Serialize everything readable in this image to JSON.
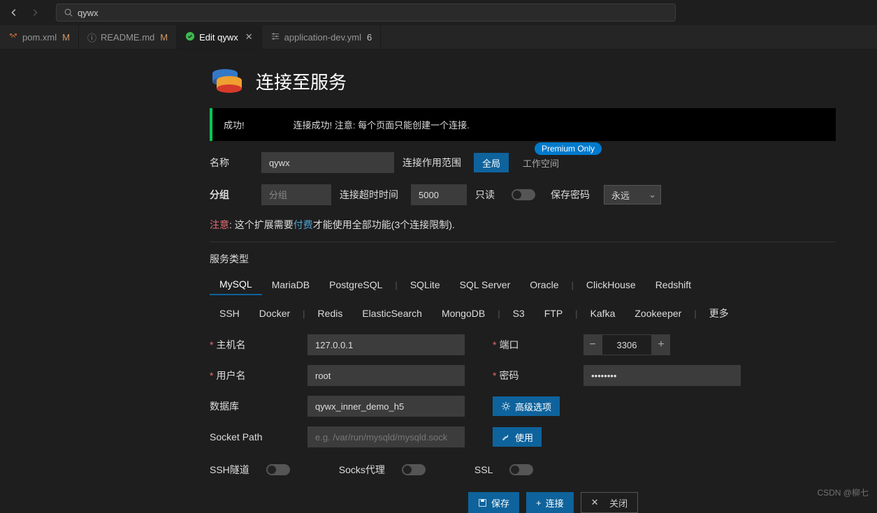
{
  "topbar": {
    "search_value": "qywx"
  },
  "tabs": [
    {
      "label": "pom.xml",
      "badge": "M"
    },
    {
      "label": "README.md",
      "badge": "M"
    },
    {
      "label": "Edit qywx",
      "active": true
    },
    {
      "label": "application-dev.yml",
      "badge": "6"
    }
  ],
  "page": {
    "title": "连接至服务",
    "alert_success": "成功!",
    "alert_msg": "连接成功! 注意: 每个页面只能创建一个连接."
  },
  "form": {
    "name_label": "名称",
    "name_value": "qywx",
    "scope_label": "连接作用范围",
    "scope_global": "全局",
    "scope_workspace": "工作空间",
    "premium_badge": "Premium Only",
    "group_label": "分组",
    "group_placeholder": "分组",
    "timeout_label": "连接超时时间",
    "timeout_value": "5000",
    "readonly_label": "只读",
    "savepwd_label": "保存密码",
    "savepwd_value": "永远",
    "notice_prefix": "注意",
    "notice_mid": ": 这个扩展需要",
    "notice_link": "付费",
    "notice_suffix": "才能使用全部功能(3个连接限制).",
    "service_type_label": "服务类型"
  },
  "service_types_row1": [
    "MySQL",
    "MariaDB",
    "PostgreSQL",
    "|",
    "SQLite",
    "SQL Server",
    "Oracle",
    "|",
    "ClickHouse",
    "Redshift"
  ],
  "service_types_row2": [
    "SSH",
    "Docker",
    "|",
    "Redis",
    "ElasticSearch",
    "MongoDB",
    "|",
    "S3",
    "FTP",
    "|",
    "Kafka",
    "Zookeeper",
    "|",
    "更多"
  ],
  "conn": {
    "host_label": "主机名",
    "host_value": "127.0.0.1",
    "port_label": "端口",
    "port_value": "3306",
    "user_label": "用户名",
    "user_value": "root",
    "pwd_label": "密码",
    "pwd_value": "••••••••",
    "db_label": "数据库",
    "db_value": "qywx_inner_demo_h5",
    "adv_label": "高级选项",
    "socket_label": "Socket Path",
    "socket_placeholder": "e.g. /var/run/mysqld/mysqld.sock",
    "use_label": "使用",
    "ssh_label": "SSH隧道",
    "socks_label": "Socks代理",
    "ssl_label": "SSL"
  },
  "footer": {
    "save": "保存",
    "connect": "连接",
    "close": "关闭"
  },
  "watermark": "CSDN @柳七"
}
